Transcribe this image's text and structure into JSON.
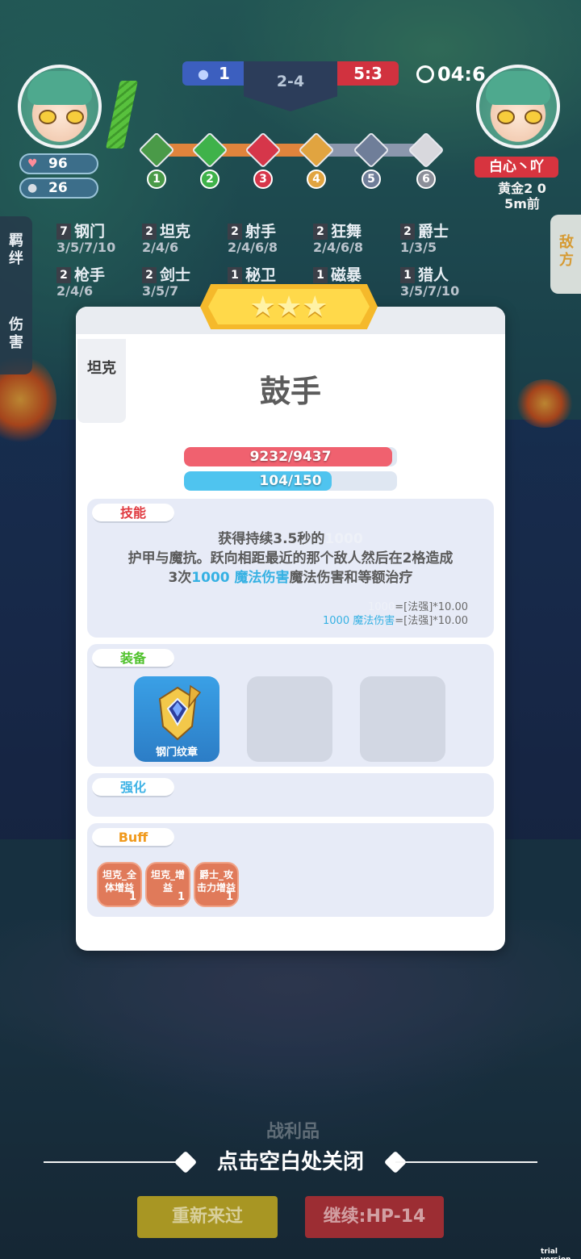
{
  "hud": {
    "player_hp": "96",
    "player_coins": "26",
    "blue_score": "1",
    "stage": "2-4",
    "red_score": "5:3",
    "timer": "04:6",
    "opponent_name": "白心丶吖",
    "opponent_rank": "黄金2 0",
    "opponent_time": "5m前",
    "stage_nodes": [
      "1",
      "2",
      "3",
      "4",
      "5",
      "6"
    ]
  },
  "side_left": {
    "tab1": "羁绊",
    "tab2": "伤害"
  },
  "side_right": {
    "tab1": "敌方"
  },
  "synergies": [
    {
      "count": "7",
      "name": "钢门",
      "levels": "3/5/7/10"
    },
    {
      "count": "2",
      "name": "坦克",
      "levels": "2/4/6"
    },
    {
      "count": "2",
      "name": "射手",
      "levels": "2/4/6/8"
    },
    {
      "count": "2",
      "name": "狂舞",
      "levels": "2/4/6/8"
    },
    {
      "count": "2",
      "name": "爵士",
      "levels": "1/3/5"
    },
    {
      "count": "2",
      "name": "枪手",
      "levels": "2/4/6"
    },
    {
      "count": "2",
      "name": "剑士",
      "levels": "3/5/7"
    },
    {
      "count": "1",
      "name": "秘卫",
      "levels": ""
    },
    {
      "count": "1",
      "name": "磁暴",
      "levels": ""
    },
    {
      "count": "1",
      "name": "猎人",
      "levels": "3/5/7/10"
    }
  ],
  "modal": {
    "stars": "★★★",
    "class_tag": "坦克",
    "unit_name": "鼓手",
    "hp_text": "9232/9437",
    "hp_fraction": 0.978,
    "mana_text": "104/150",
    "mana_fraction": 0.693,
    "skill_label": "技能",
    "skill_line1a": "获得持续3.5秒的",
    "skill_line1b": "1000",
    "skill_line2": "护甲与魔抗。跃向相距最近的那个敌人然后在2格造成",
    "skill_line3a": "3次",
    "skill_line3b": "1000 魔法伤害",
    "skill_line3c": "魔法伤害和等额治疗",
    "formula1a": "1000",
    "formula1b": "=[法强]*10.00",
    "formula2a": "1000 魔法伤害",
    "formula2b": "=[法强]*10.00",
    "equip_label": "装备",
    "equip_item_name": "钢门纹章",
    "enhance_label": "强化",
    "buff_label": "Buff",
    "buffs": [
      {
        "line1": "坦克_全",
        "line2": "体增益",
        "count": "1"
      },
      {
        "line1": "坦克_增",
        "line2": "益",
        "count": "1"
      },
      {
        "line1": "爵士_攻",
        "line2": "击力增益",
        "count": "1"
      }
    ]
  },
  "bottom": {
    "behind_label": "战利品",
    "close_hint": "点击空白处关闭",
    "retry_button": "重新来过",
    "continue_button": "继续:HP-14",
    "watermark": "trial version"
  },
  "colors": {
    "hp": "#f0616f",
    "mana": "#4fc4ef",
    "skill_label": "#e0393f",
    "equip_label": "#4fc12b",
    "enhance_label": "#3fb3e6",
    "buff_label": "#f09a1e"
  }
}
